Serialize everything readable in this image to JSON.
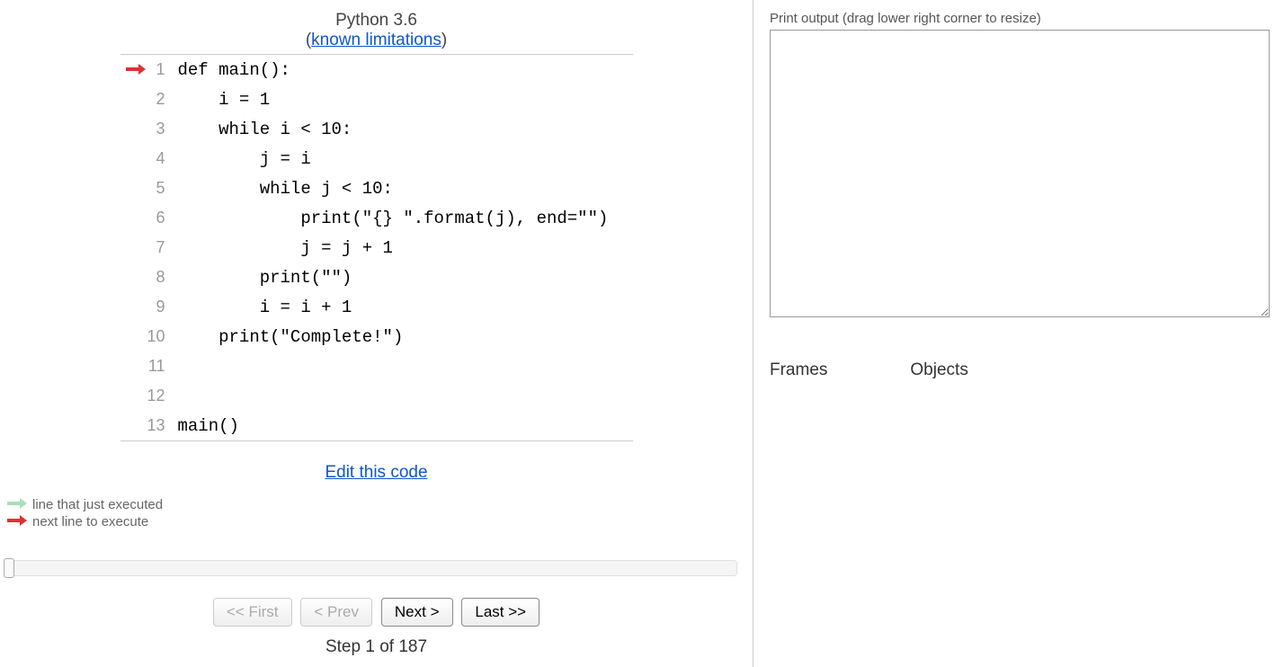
{
  "header": {
    "language": "Python 3.6",
    "limitations_prefix": "(",
    "limitations_link": "known limitations",
    "limitations_suffix": ")"
  },
  "code": {
    "current_line": 1,
    "lines": [
      "def main():",
      "    i = 1",
      "    while i < 10:",
      "        j = i",
      "        while j < 10:",
      "            print(\"{} \".format(j), end=\"\")",
      "            j = j + 1",
      "        print(\"\")",
      "        i = i + 1",
      "    print(\"Complete!\")",
      "",
      "",
      "main()"
    ]
  },
  "edit_link": "Edit this code",
  "legend": {
    "prev": "line that just executed",
    "next": "next line to execute"
  },
  "controls": {
    "first": "<< First",
    "prev": "< Prev",
    "next": "Next >",
    "last": "Last >>",
    "first_disabled": true,
    "prev_disabled": true
  },
  "step": {
    "label_prefix": "Step ",
    "current": 1,
    "of": " of ",
    "total": 187
  },
  "output": {
    "label": "Print output (drag lower right corner to resize)",
    "text": ""
  },
  "frames_label": "Frames",
  "objects_label": "Objects"
}
